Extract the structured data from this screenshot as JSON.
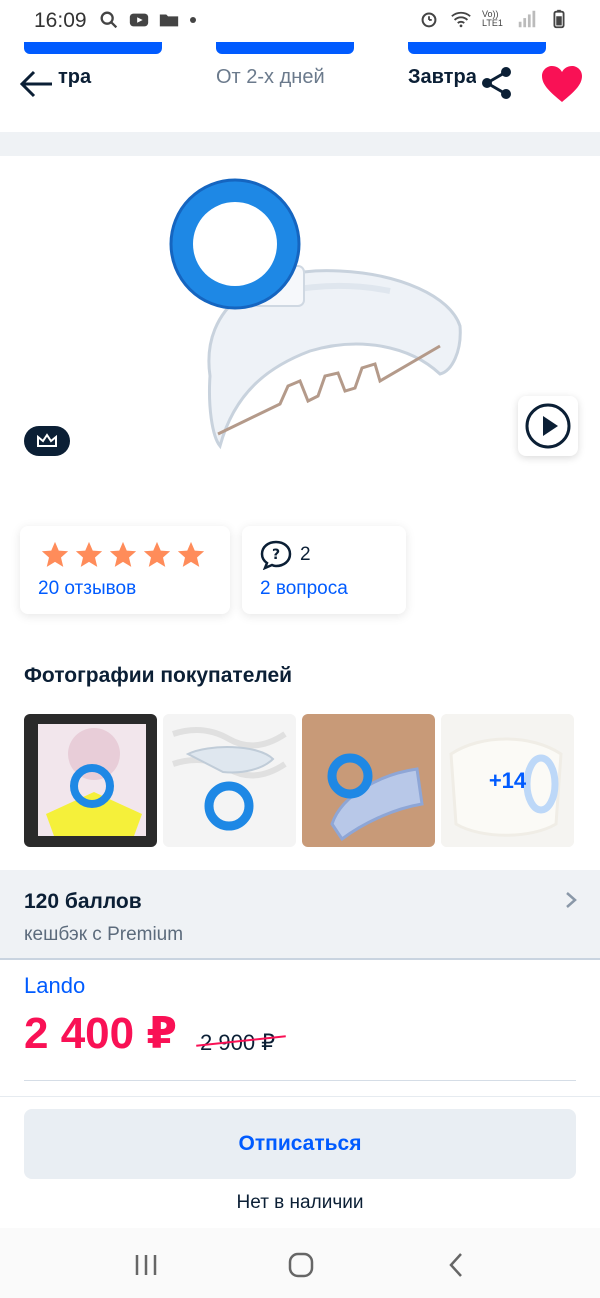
{
  "status_bar": {
    "time": "16:09",
    "left_icons": [
      "search-icon",
      "youtube-icon",
      "folder-icon",
      "dot-icon"
    ],
    "right_icons": [
      "alarm-icon",
      "wifi-icon",
      "volte-icon",
      "signal-icon",
      "battery-icon"
    ],
    "volte_label": "Vo)) LTE1"
  },
  "header": {
    "tab_left": "тра",
    "tab_middle": "От 2-х дней",
    "tab_right": "Завтра"
  },
  "product": {
    "reviews_label": "20 отзывов",
    "rating_stars": 5,
    "questions_count": "2",
    "questions_label": "2 вопроса"
  },
  "photos": {
    "title": "Фотографии покупателей",
    "more_label": "+14"
  },
  "cashback": {
    "title": "120 баллов",
    "subtitle": "кешбэк с Premium"
  },
  "pricing": {
    "seller": "Lando",
    "price": "2 400 ₽",
    "old_price": "2 900 ₽"
  },
  "actions": {
    "unsubscribe_label": "Отписаться",
    "stock_status": "Нет в наличии"
  },
  "colors": {
    "accent": "#005bff",
    "price": "#f91155",
    "heart": "#f91155",
    "star": "#ff8c5a"
  }
}
